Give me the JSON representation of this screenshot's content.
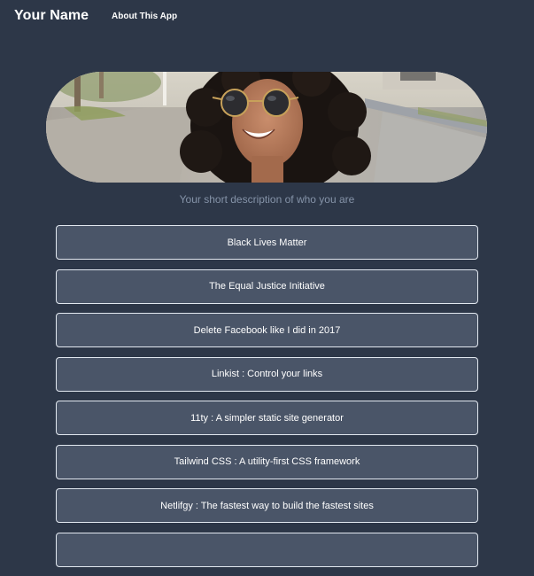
{
  "nav": {
    "brand": "Your Name",
    "about_link": "About This App"
  },
  "profile": {
    "tagline": "Your short description of who you are"
  },
  "links": [
    {
      "label": "Black Lives Matter"
    },
    {
      "label": "The Equal Justice Initiative"
    },
    {
      "label": "Delete Facebook like I did in 2017"
    },
    {
      "label": "Linkist : Control your links"
    },
    {
      "label": "11ty : A simpler static site generator"
    },
    {
      "label": "Tailwind CSS : A utility-first CSS framework"
    },
    {
      "label": "Netlifgy : The fastest way to build the fastest sites"
    },
    {
      "label": ""
    }
  ],
  "colors": {
    "background": "#2d3748",
    "button_fill": "#4a5568",
    "button_border": "#e2e8f0",
    "tagline": "#8593a8"
  }
}
